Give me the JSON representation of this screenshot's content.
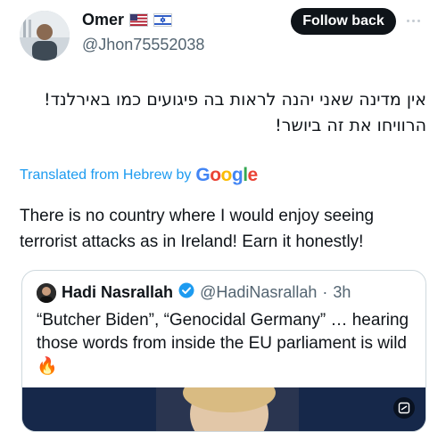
{
  "author": {
    "name": "Omer",
    "handle": "@Jhon75552038",
    "flags": [
      "us-flag-icon",
      "israel-flag-icon"
    ]
  },
  "actions": {
    "follow_label": "Follow back",
    "more": "more-icon"
  },
  "post": {
    "text_line1": "אין מדינה שאני יהנה לראות בה פיגועים כמו באירלנד!",
    "text_line2": "הרוויחו את זה ביושר!",
    "translated_prefix": "Translated from Hebrew by",
    "translator": "Google",
    "translation": "There is no country where I would enjoy seeing terrorist attacks as in Ireland! Earn it honestly!"
  },
  "quote": {
    "name": "Hadi Nasrallah",
    "handle": "@HadiNasrallah",
    "separator": "·",
    "time": "3h",
    "verified": "verified-badge-icon",
    "text": "“Butcher Biden”, “Genocidal Germany” … hearing those words from inside the EU parliament is wild 🔥"
  },
  "colors": {
    "link": "#1d9bf0",
    "verified": "#1d9bf0",
    "muted": "#536471",
    "button_bg": "#0f1419",
    "google_blue": "#4285f4",
    "google_red": "#ea4335",
    "google_yellow": "#fbbc05",
    "google_green": "#34a853"
  }
}
